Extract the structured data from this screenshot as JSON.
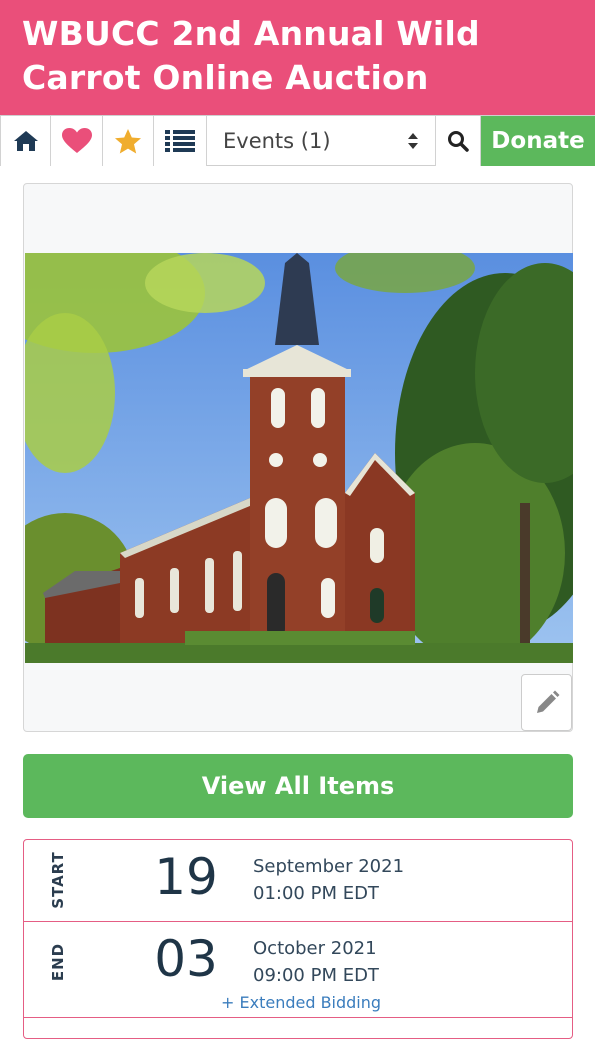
{
  "header": {
    "title": "WBUCC 2nd Annual Wild Carrot Online Auction"
  },
  "navbar": {
    "icons": [
      "home-icon",
      "heart-icon",
      "star-icon",
      "list-icon",
      "search-icon"
    ],
    "events_select": "Events (1)",
    "donate_label": "Donate"
  },
  "card": {
    "image_alt": "Church building",
    "edit_icon": "pencil-icon"
  },
  "view_all_label": "View All Items",
  "schedule": {
    "start": {
      "label": "START",
      "day": "19",
      "month_year": "September 2021",
      "time": "01:00 PM EDT"
    },
    "end": {
      "label": "END",
      "day": "03",
      "month_year": "October 2021",
      "time": "09:00 PM EDT",
      "extended": "+ Extended Bidding"
    }
  },
  "colors": {
    "brand_pink": "#ea4f7a",
    "green": "#5cb85c",
    "icon_navy": "#1f3a55",
    "heart": "#ea4f7a",
    "star": "#f0ad2e"
  }
}
